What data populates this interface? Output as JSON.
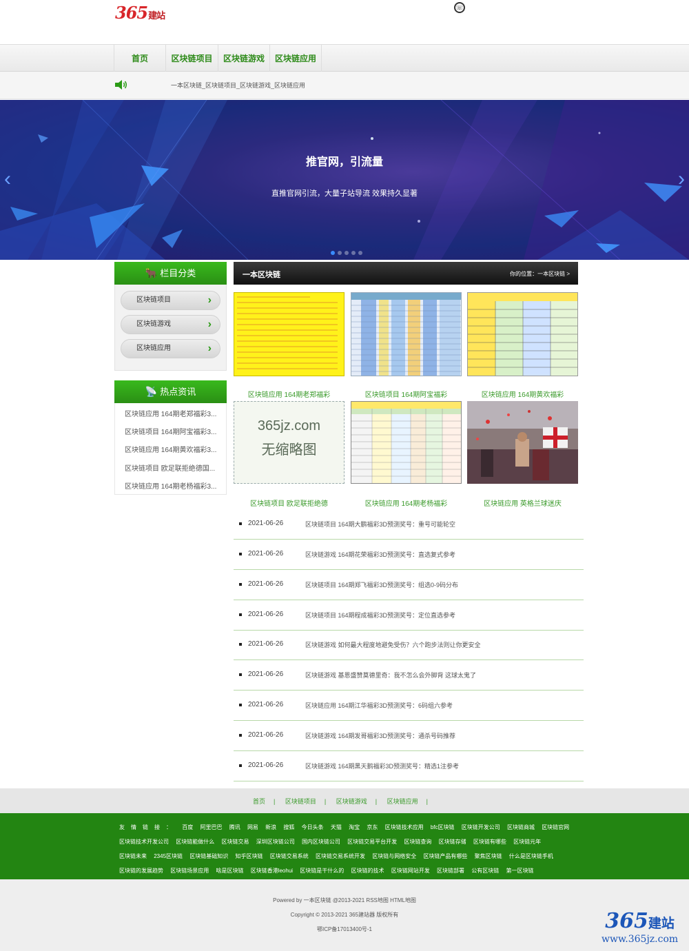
{
  "site": {
    "logo_num": "365",
    "logo_text": "建站",
    "top_icon": "phone-icon"
  },
  "nav": [
    "首页",
    "区块链项目",
    "区块链游戏",
    "区块链应用"
  ],
  "notice": {
    "icon": "speaker-icon",
    "text": "一本区块链_区块链项目_区块链游戏_区块链应用"
  },
  "banner": {
    "title": "推官网，引流量",
    "subtitle": "直推官网引流，大量子站导流 效果持久显著",
    "prev": "‹",
    "next": "›",
    "dot_count": 5,
    "active_dot": 0
  },
  "sidebar": {
    "cat_title": "栏目分类",
    "categories": [
      "区块链项目",
      "区块链游戏",
      "区块链应用"
    ],
    "chev": "›",
    "hot_title": "热点资讯",
    "hot": [
      "区块链应用 164期老郑福彩3...",
      "区块链项目 164期阿宝福彩3...",
      "区块链应用 164期黄欢福彩3...",
      "区块链项目 欧足联拒绝德国...",
      "区块链应用 164期老杨福彩3..."
    ]
  },
  "main": {
    "title": "一本区块链",
    "crumb": "你的位置：一本区块链 >",
    "thumbs": [
      {
        "caption": "区块链应用 164期老郑福彩"
      },
      {
        "caption": "区块链项目 164期阿宝福彩"
      },
      {
        "caption": "区块链应用 164期黄欢福彩"
      },
      {
        "caption": "区块链项目 欧足联拒绝德",
        "placeholder_line1": "365jz.com",
        "placeholder_line2": "无缩略图"
      },
      {
        "caption": "区块链应用 164期老杨福彩"
      },
      {
        "caption": "区块链应用 英格兰球迷庆"
      }
    ],
    "list": [
      {
        "date": "2021-06-26",
        "title": "区块链项目 164期大鹏福彩3D预测奖号：重号可能轮空"
      },
      {
        "date": "2021-06-26",
        "title": "区块链游戏 164期花荣福彩3D预测奖号：直选复式参考"
      },
      {
        "date": "2021-06-26",
        "title": "区块链项目 164期郑飞福彩3D预测奖号：组选0-9码分布"
      },
      {
        "date": "2021-06-26",
        "title": "区块链项目 164期程成福彩3D预测奖号：定位直选参考"
      },
      {
        "date": "2021-06-26",
        "title": "区块链游戏 如何最大程度地避免受伤？六个跑步法则让你更安全"
      },
      {
        "date": "2021-06-26",
        "title": "区块链游戏 基恩盛赞莫德里奇：我不怎么会外脚背 这球太鬼了"
      },
      {
        "date": "2021-06-26",
        "title": "区块链应用 164期江华福彩3D预测奖号：6码组六参考"
      },
      {
        "date": "2021-06-26",
        "title": "区块链游戏 164期发哥福彩3D预测奖号：通杀号码推荐"
      },
      {
        "date": "2021-06-26",
        "title": "区块链游戏 164期黑天鹅福彩3D预测奖号：精选1注参考"
      }
    ]
  },
  "footer_nav": [
    "首页",
    "区块链项目",
    "区块链游戏",
    "区块链应用"
  ],
  "footer_sep": "|",
  "links": {
    "label": "友情链接：",
    "items": [
      "百度",
      "阿里巴巴",
      "腾讯",
      "网易",
      "新浪",
      "搜狐",
      "今日头条",
      "天猫",
      "淘宝",
      "京东",
      "区块链技术应用",
      "bfc区块链",
      "区块链开发公司",
      "区块链商城",
      "区块链官网",
      "区块链技术开发公司",
      "区块链能做什么",
      "区块链交易",
      "深圳区块链公司",
      "国内区块链公司",
      "区块链交易平台开发",
      "区块链查询",
      "区块链存储",
      "区块链有哪些",
      "区块链元年",
      "区块链未来",
      "2345区块链",
      "区块链基础知识",
      "知乎区块链",
      "区块链交易系统",
      "区块链交易系统开发",
      "区块链与网络安全",
      "区块链产品有哪些",
      "聚焦区块链",
      "什么是区块链手机",
      "区块链的发展趋势",
      "区块链场景应用",
      "啥是区块链",
      "区块链香港leohui",
      "区块链是干什么的",
      "区块链的技术",
      "区块链网站开发",
      "区块链部署",
      "公有区块链",
      "第一区块链"
    ]
  },
  "copyright": {
    "line1": "Powered by 一本区块链 @2013-2021 RSS地图 HTML地图",
    "line2": "Copyright © 2013-2021 365建站器 版权所有",
    "line3": "鄂ICP备17013400号-1"
  },
  "watermark": {
    "num": "365",
    "zh": "建站",
    "url": "www.365jz.com"
  },
  "colors": {
    "green": "#2a9a15",
    "footer_green": "#238512",
    "logo_red": "#d8262a",
    "wm_blue": "#1c56b8"
  }
}
